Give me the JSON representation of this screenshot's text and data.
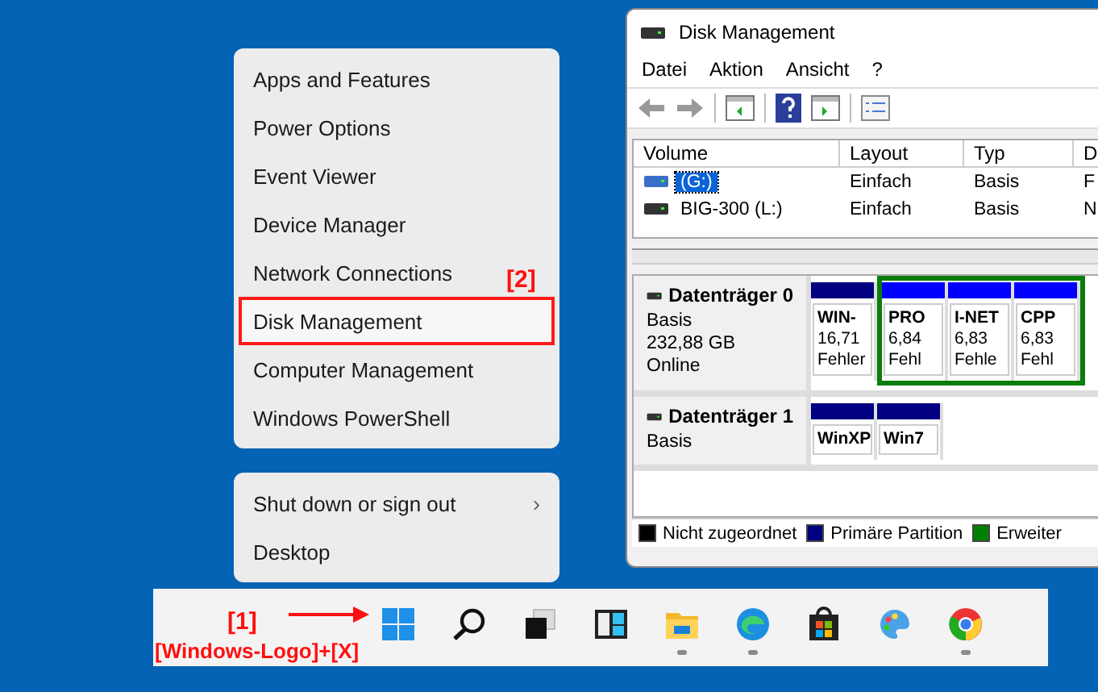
{
  "start_menu": {
    "items": [
      {
        "label": "Apps and Features",
        "selected": false
      },
      {
        "label": "Power Options",
        "selected": false
      },
      {
        "label": "Event Viewer",
        "selected": false
      },
      {
        "label": "Device Manager",
        "selected": false
      },
      {
        "label": "Network Connections",
        "selected": false
      },
      {
        "label": "Disk Management",
        "selected": true
      },
      {
        "label": "Computer Management",
        "selected": false
      },
      {
        "label": "Windows PowerShell",
        "selected": false
      }
    ],
    "power_items": [
      {
        "label": "Shut down or sign out",
        "arrow": "›"
      },
      {
        "label": "Desktop"
      }
    ]
  },
  "annotations": {
    "menu_step": "[2]",
    "taskbar_step": "[1]",
    "shortcut": "[Windows-Logo]+[X]"
  },
  "disk_window": {
    "title": "Disk Management",
    "menu": [
      "Datei",
      "Aktion",
      "Ansicht",
      "?"
    ],
    "columns": [
      "Volume",
      "Layout",
      "Typ",
      "D"
    ],
    "rows": [
      {
        "cells": [
          "(G:)",
          "Einfach",
          "Basis",
          "F"
        ],
        "selected": true
      },
      {
        "cells": [
          "BIG-300 (L:)",
          "Einfach",
          "Basis",
          "N"
        ],
        "selected": false
      }
    ],
    "disks": [
      {
        "name": "Datenträger 0",
        "info": [
          "Basis",
          "232,88 GB",
          "Online"
        ],
        "partitions": [
          {
            "kind": "primary",
            "name": "WIN-",
            "size": "16,71",
            "status": "Fehler"
          },
          {
            "kind": "logical",
            "name": "PRO",
            "size": "6,84",
            "status": "Fehl"
          },
          {
            "kind": "logical",
            "name": "I-NET",
            "size": "6,83",
            "status": "Fehle"
          },
          {
            "kind": "logical",
            "name": "CPP",
            "size": "6,83",
            "status": "Fehl"
          }
        ]
      },
      {
        "name": "Datenträger 1",
        "info": [
          "Basis"
        ],
        "partitions": [
          {
            "kind": "primary",
            "name": "WinXP"
          },
          {
            "kind": "primary",
            "name": "Win7"
          }
        ]
      }
    ],
    "legend": [
      {
        "label": "Nicht zugeordnet",
        "color": "#000000"
      },
      {
        "label": "Primäre Partition",
        "color": "#000080"
      },
      {
        "label": "Erweiter",
        "color": "#008000"
      }
    ]
  },
  "taskbar": {
    "icons": [
      {
        "kind": "start",
        "running": false
      },
      {
        "kind": "search",
        "running": false
      },
      {
        "kind": "taskview",
        "running": false
      },
      {
        "kind": "widgets",
        "running": false
      },
      {
        "kind": "explorer",
        "running": true
      },
      {
        "kind": "edge",
        "running": true
      },
      {
        "kind": "store",
        "running": false
      },
      {
        "kind": "paint",
        "running": false
      },
      {
        "kind": "chrome",
        "running": true
      }
    ]
  }
}
